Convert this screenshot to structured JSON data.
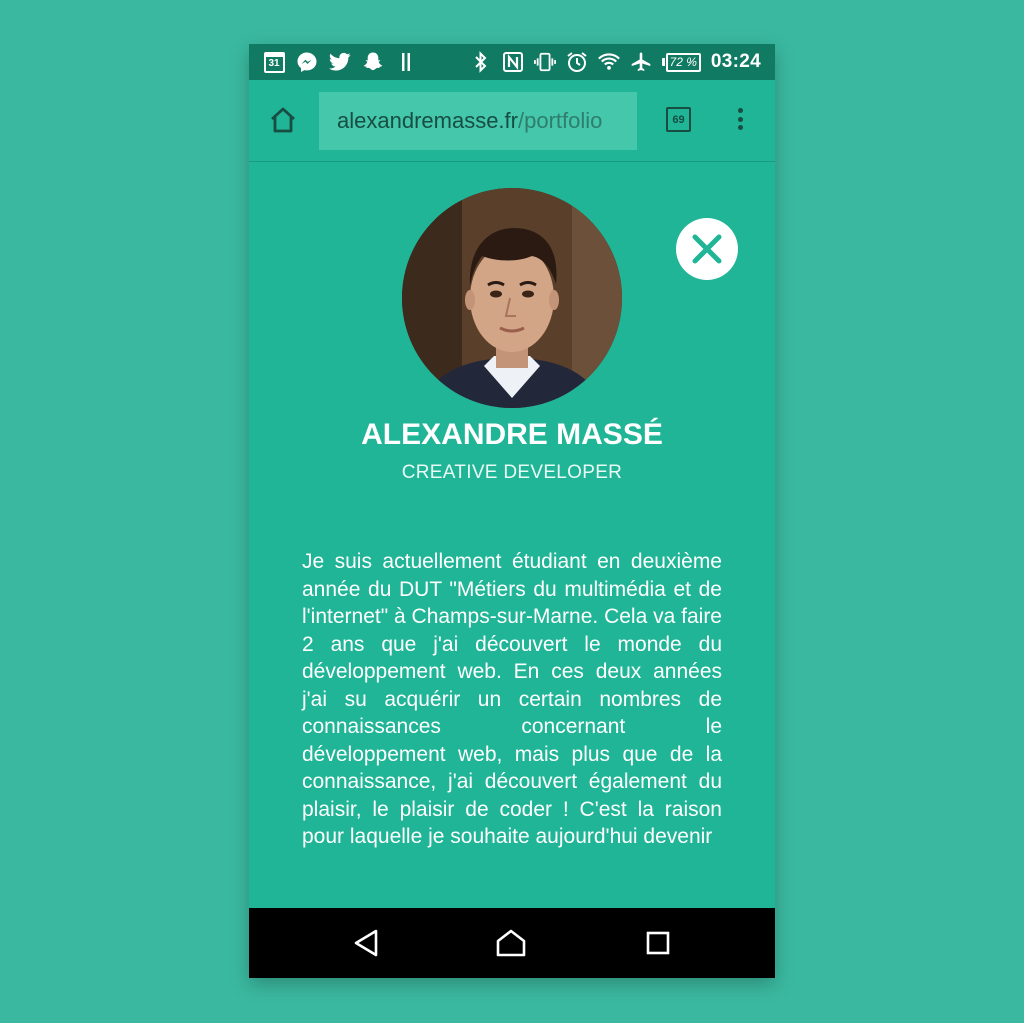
{
  "status_bar": {
    "calendar_day": "31",
    "left_icons": [
      "calendar-icon",
      "messenger-icon",
      "twitter-icon",
      "snapchat-icon",
      "pause-icon"
    ],
    "right_icons": [
      "bluetooth-icon",
      "nfc-icon",
      "vibrate-icon",
      "alarm-icon",
      "wifi-icon",
      "airplane-icon"
    ],
    "battery": "72 %",
    "time": "03:24"
  },
  "browser": {
    "url_domain": "alexandremasse.fr",
    "url_path": "/portfolio",
    "tab_count": "69"
  },
  "profile": {
    "name": "ALEXANDRE MASSÉ",
    "role": "CREATIVE DEVELOPER",
    "bio": "Je suis actuellement étudiant en deuxième année du DUT \"Métiers du multimédia et de l'internet\" à Champs-sur-Marne. Cela va faire 2 ans que j'ai découvert le monde du développement web. En ces deux années j'ai su acquérir un certain nombres de connaissances concernant le développement web, mais plus que de la connaissance, j'ai découvert également du plaisir, le plaisir de coder ! C'est la raison pour laquelle je souhaite aujourd'hui devenir"
  },
  "colors": {
    "page_background": "#3bb9a0",
    "screen": "#1fb596",
    "status_bar": "#117a63",
    "url_box": "#44c7aa",
    "dark_icon": "#174d43"
  },
  "nav_bar": {
    "icons": [
      "back-icon",
      "home-icon",
      "recents-icon"
    ]
  }
}
